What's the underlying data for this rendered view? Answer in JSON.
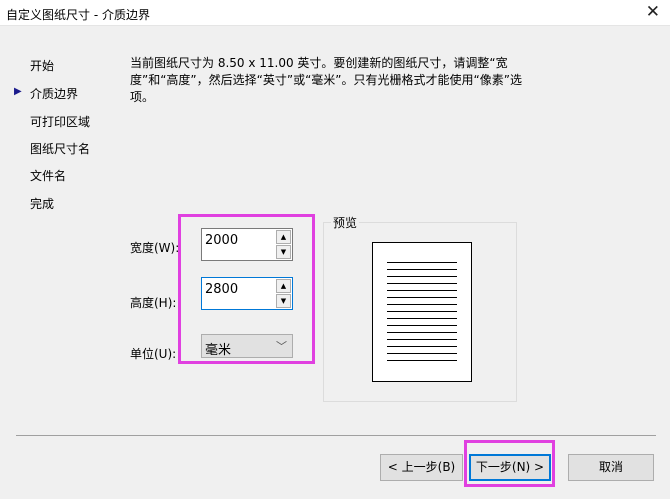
{
  "window": {
    "title": "自定义图纸尺寸 - 介质边界",
    "close_icon": "close-icon"
  },
  "nav": {
    "items": [
      {
        "label": "开始",
        "current": false
      },
      {
        "label": "介质边界",
        "current": true
      },
      {
        "label": "可打印区域",
        "current": false
      },
      {
        "label": "图纸尺寸名",
        "current": false
      },
      {
        "label": "文件名",
        "current": false
      },
      {
        "label": "完成",
        "current": false
      }
    ]
  },
  "description": "当前图纸尺寸为 8.50 x 11.00 英寸。要创建新的图纸尺寸，请调整“宽度”和“高度”，然后选择“英寸”或“毫米”。只有光栅格式才能使用“像素”选项。",
  "form": {
    "width_label": "宽度(W):",
    "width_value": "2000",
    "height_label": "高度(H):",
    "height_value": "2800",
    "unit_label": "单位(U):",
    "unit_value": "毫米"
  },
  "preview": {
    "label": "预览",
    "line_count": 15
  },
  "buttons": {
    "back": "< 上一步(B)",
    "next": "下一步(N) >",
    "cancel": "取消"
  },
  "colors": {
    "highlight": "#e040e0",
    "focus": "#0078d7"
  }
}
